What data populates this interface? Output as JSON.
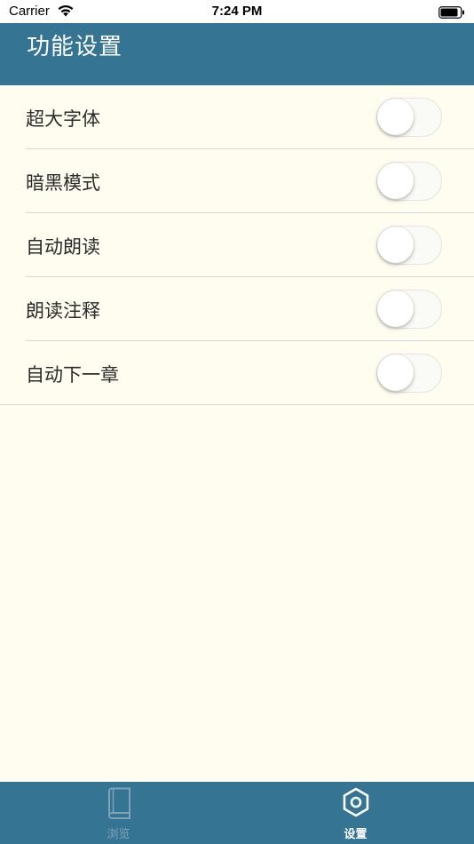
{
  "status_bar": {
    "carrier": "Carrier",
    "time": "7:24 PM"
  },
  "header": {
    "title": "功能设置",
    "background_color": "#357493"
  },
  "settings": {
    "items": [
      {
        "label": "超大字体",
        "enabled": false
      },
      {
        "label": "暗黑模式",
        "enabled": false
      },
      {
        "label": "自动朗读",
        "enabled": false
      },
      {
        "label": "朗读注释",
        "enabled": false
      },
      {
        "label": "自动下一章",
        "enabled": false
      }
    ]
  },
  "tab_bar": {
    "tabs": [
      {
        "label": "浏览",
        "icon": "book-icon",
        "active": false
      },
      {
        "label": "设置",
        "icon": "gear-icon",
        "active": true
      }
    ]
  },
  "colors": {
    "page_background": "#fffdf0",
    "accent": "#357493"
  }
}
